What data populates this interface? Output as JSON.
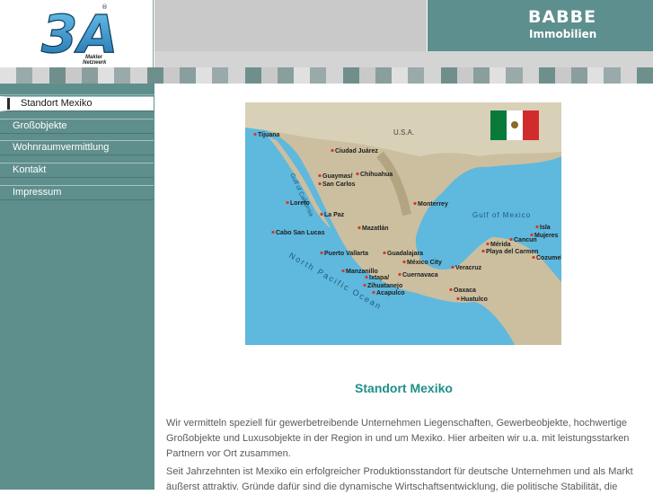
{
  "logo": {
    "mark": "3A",
    "sub1": "Makler",
    "sub2": "Netzwerk",
    "registered": "®"
  },
  "brand": {
    "line1": "BABBE",
    "line2": "Immobilien"
  },
  "nav": [
    {
      "label": "Standort Mexiko",
      "active": true
    },
    {
      "label": "Großobjekte",
      "active": false
    },
    {
      "label": "Wohnraumvermittlung",
      "active": false
    },
    {
      "label": "Kontakt",
      "active": false
    },
    {
      "label": "Impressum",
      "active": false
    }
  ],
  "map": {
    "country_label": "U.S.A.",
    "gulf_label": "Gulf of Mexico",
    "california_label": "Gulf of California",
    "ocean_label": "North Pacific Ocean",
    "cities": [
      "Tijuana",
      "Ciudad Juárez",
      "Chihuahua",
      "Guaymas/",
      "San Carlos",
      "Loreto",
      "La Paz",
      "Cabo San Lucas",
      "Monterrey",
      "Mazatlán",
      "Puerto Vallarta",
      "Guadalajara",
      "México City",
      "Manzanillo",
      "Cuernavaca",
      "Ixtapa/",
      "Zihuatanejo",
      "Acapulco",
      "Veracruz",
      "Oaxaca",
      "Huatulco",
      "Isla",
      "Mujeres",
      "Cancun",
      "Mérida",
      "Playa del Carmen",
      "Cozumel"
    ],
    "colors": {
      "ocean": "#5fb8dd",
      "land": "#c9c0a8",
      "pin": "#d23a2a"
    }
  },
  "content": {
    "title": "Standort Mexiko",
    "p1": "Wir vermitteln speziell für gewerbetreibende Unternehmen Liegenschaften, Gewerbeobjekte, hochwertige Großobjekte und Luxusobjekte in der Region in und um Mexiko. Hier arbeiten wir u.a. mit leistungsstarken Partnern vor Ort zusammen.",
    "p2": "Seit Jahrzehnten ist Mexiko ein erfolgreicher Produktionsstandort für deutsche Unternehmen und als Markt äußerst attraktiv. Gründe dafür sind die dynamische Wirtschaftsentwicklung, die politische Stabilität, die"
  },
  "colors": {
    "teal": "#5f8f8c",
    "title": "#1f8f88",
    "brand_bg": "#5c8f8d"
  }
}
